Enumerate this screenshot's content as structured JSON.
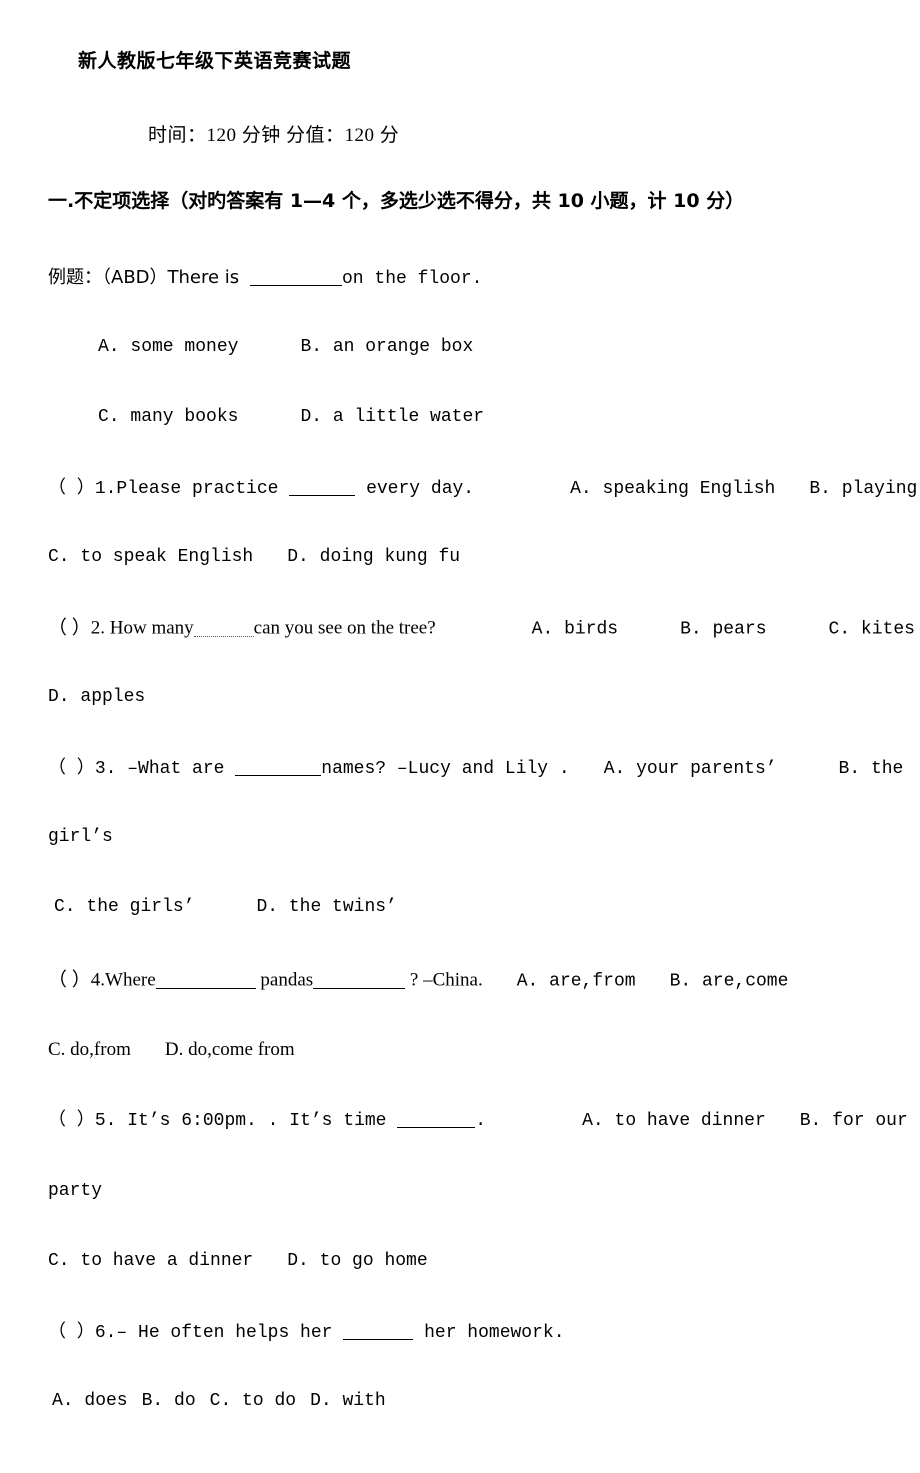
{
  "document": {
    "title": "新人教版七年级下英语竞赛试题",
    "exam_info": "时间：120 分钟    分值：120 分",
    "section_heading": "一.不定项选择（对旳答案有 1—4 个，多选少选不得分，共 10 小题，计 10 分）",
    "example": {
      "label": "例题：（ABD）There is",
      "tail": "on the floor.",
      "options_line1_a": "A. some money",
      "options_line1_b": "B. an orange box",
      "options_line2_c": "C. many books",
      "options_line2_d": "D. a little water"
    },
    "questions": [
      {
        "marker": "（  ）",
        "number": "1.",
        "stem_pre": "Please practice",
        "stem_post": "every day.",
        "opt_a": "A. speaking English",
        "opt_b": "B. playing the piano",
        "opt_c": "C. to speak English",
        "opt_d": "D. doing kung fu"
      },
      {
        "marker": "（      ）",
        "number": "2.",
        "stem_pre": "How many",
        "stem_post": "can you see on the tree?",
        "opt_a": "A. birds",
        "opt_b": "B. pears",
        "opt_c": "C. kites",
        "opt_d": "D. apples"
      },
      {
        "marker": "（      ）",
        "number": "3.",
        "stem_pre": "–What are",
        "stem_post": "names? –Lucy and Lily .",
        "opt_a": "A. your parents’",
        "opt_b_part1": "B. the",
        "opt_b_part2": "girl’s",
        "opt_c": "C. the girls’",
        "opt_d": "D. the twins’"
      },
      {
        "marker": "（      ）",
        "number": "4.",
        "stem_pre": "Where",
        "stem_mid": "pandas",
        "stem_post": "?  –China.",
        "opt_a": "A. are,from",
        "opt_b": "B. are,come",
        "opt_c": "C. do,from",
        "opt_d": "D. do,come from"
      },
      {
        "marker": "（      ）",
        "number": "5.",
        "stem_pre": "It’s 6:00pm. . It’s time",
        "stem_post": ".",
        "opt_a": "A. to have dinner",
        "opt_b_part1": "B. for our",
        "opt_b_part2": "party",
        "opt_c": "C. to have a dinner",
        "opt_d": "D. to go home"
      },
      {
        "marker": "（      ）",
        "number": "6.",
        "stem_pre": "– He often helps her",
        "stem_post": "her homework.",
        "opt_a": "A.  does",
        "opt_b": "B.  do",
        "opt_c": "C.  to do",
        "opt_d": "D.  with"
      }
    ]
  }
}
